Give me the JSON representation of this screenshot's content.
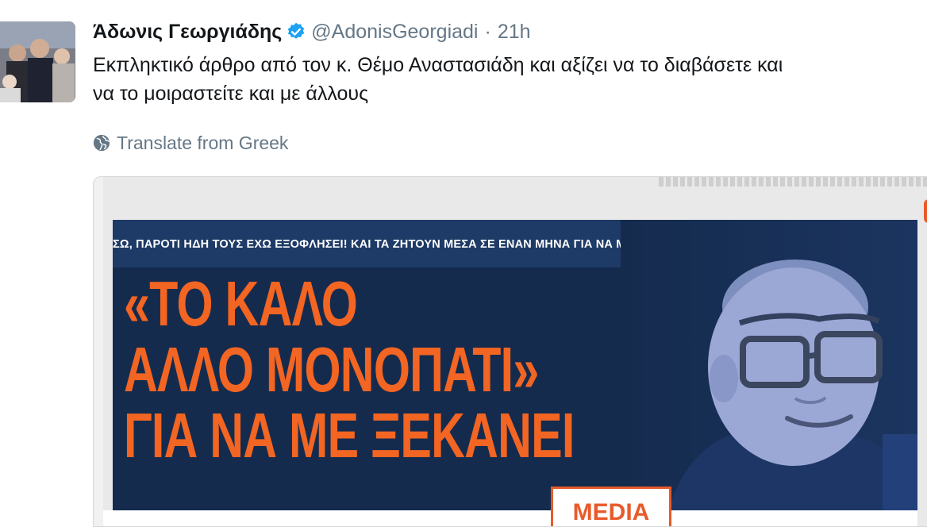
{
  "tweet": {
    "author_name": "Άδωνις Γεωργιάδης",
    "handle": "@AdonisGeorgiadi",
    "separator": "·",
    "time": "21h",
    "text_line1": "Εκπληκτικό άρθρο από τον κ. Θέμο Αναστασιάδη και αξίζει να το διαβάσετε και",
    "text_line2": "να το μοιραστείτε και με άλλους",
    "translate_label": "Translate from Greek",
    "verified": true
  },
  "media": {
    "subhead": "ΣΩ, ΠΑΡΟΤΙ ΗΔΗ ΤΟΥΣ ΕΧΩ ΕΞΟΦΛΗΣΕΙ! ΚΑΙ ΤΑ ΖΗΤΟΥΝ ΜΕΣΑ ΣΕ ΕΝΑΝ ΜΗΝΑ ΓΙΑ ΝΑ ΜΕ ΚΑΤΑΣΤΡΕΨΟΥΝ",
    "headline_line1": "«ΤΟ ΚΑΛΟ",
    "headline_line2": "ΑΛΛΟ ΜΟΝΟΠΑΤΙ»",
    "headline_line3": "ΓΙΑ ΝΑ ΜΕ ΞΕΚΑΝΕΙ",
    "tag": "MEDIA",
    "colors": {
      "banner": "#152b4e",
      "headline": "#f26522",
      "verified_badge": "#1da1f2"
    }
  },
  "icons": {
    "verified": "verified-badge-icon",
    "translate": "globe-icon"
  }
}
